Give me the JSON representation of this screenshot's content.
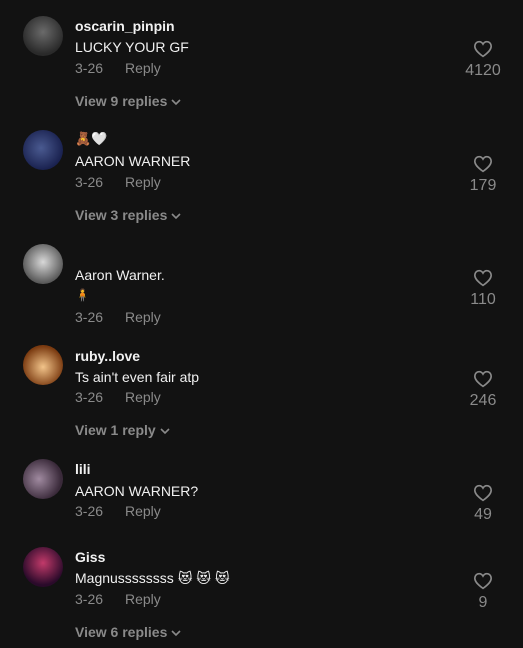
{
  "comments": [
    {
      "username": "oscarin_pinpin",
      "text": "LUCKY YOUR GF",
      "date": "3-26",
      "reply_label": "Reply",
      "likes": "4120",
      "view_replies": "View 9 replies",
      "avatar_color": "#3a3a3a"
    },
    {
      "username": "AARON WARNER",
      "top_line": "🧸🤍",
      "date": "3-26",
      "reply_label": "Reply",
      "likes": "179",
      "view_replies": "View 3 replies",
      "avatar_color": "#2b3a6a"
    },
    {
      "username": "Aaron Warner.",
      "text": "🧍",
      "date": "3-26",
      "reply_label": "Reply",
      "likes": "110",
      "avatar_color": "#9a9a9a"
    },
    {
      "username": "ruby..love",
      "text": "Ts ain't even fair atp",
      "date": "3-26",
      "reply_label": "Reply",
      "likes": "246",
      "view_replies": "View 1 reply",
      "avatar_color": "#e0a13a"
    },
    {
      "username": "lili",
      "text": "AARON WARNER?",
      "date": "3-26",
      "reply_label": "Reply",
      "likes": "49",
      "avatar_color": "#7a6b7a"
    },
    {
      "username": "Giss",
      "text": "Magnussssssss",
      "emoji": "😻",
      "date": "3-26",
      "reply_label": "Reply",
      "likes": "9",
      "view_replies": "View 6 replies",
      "avatar_color": "#5a2040"
    }
  ]
}
